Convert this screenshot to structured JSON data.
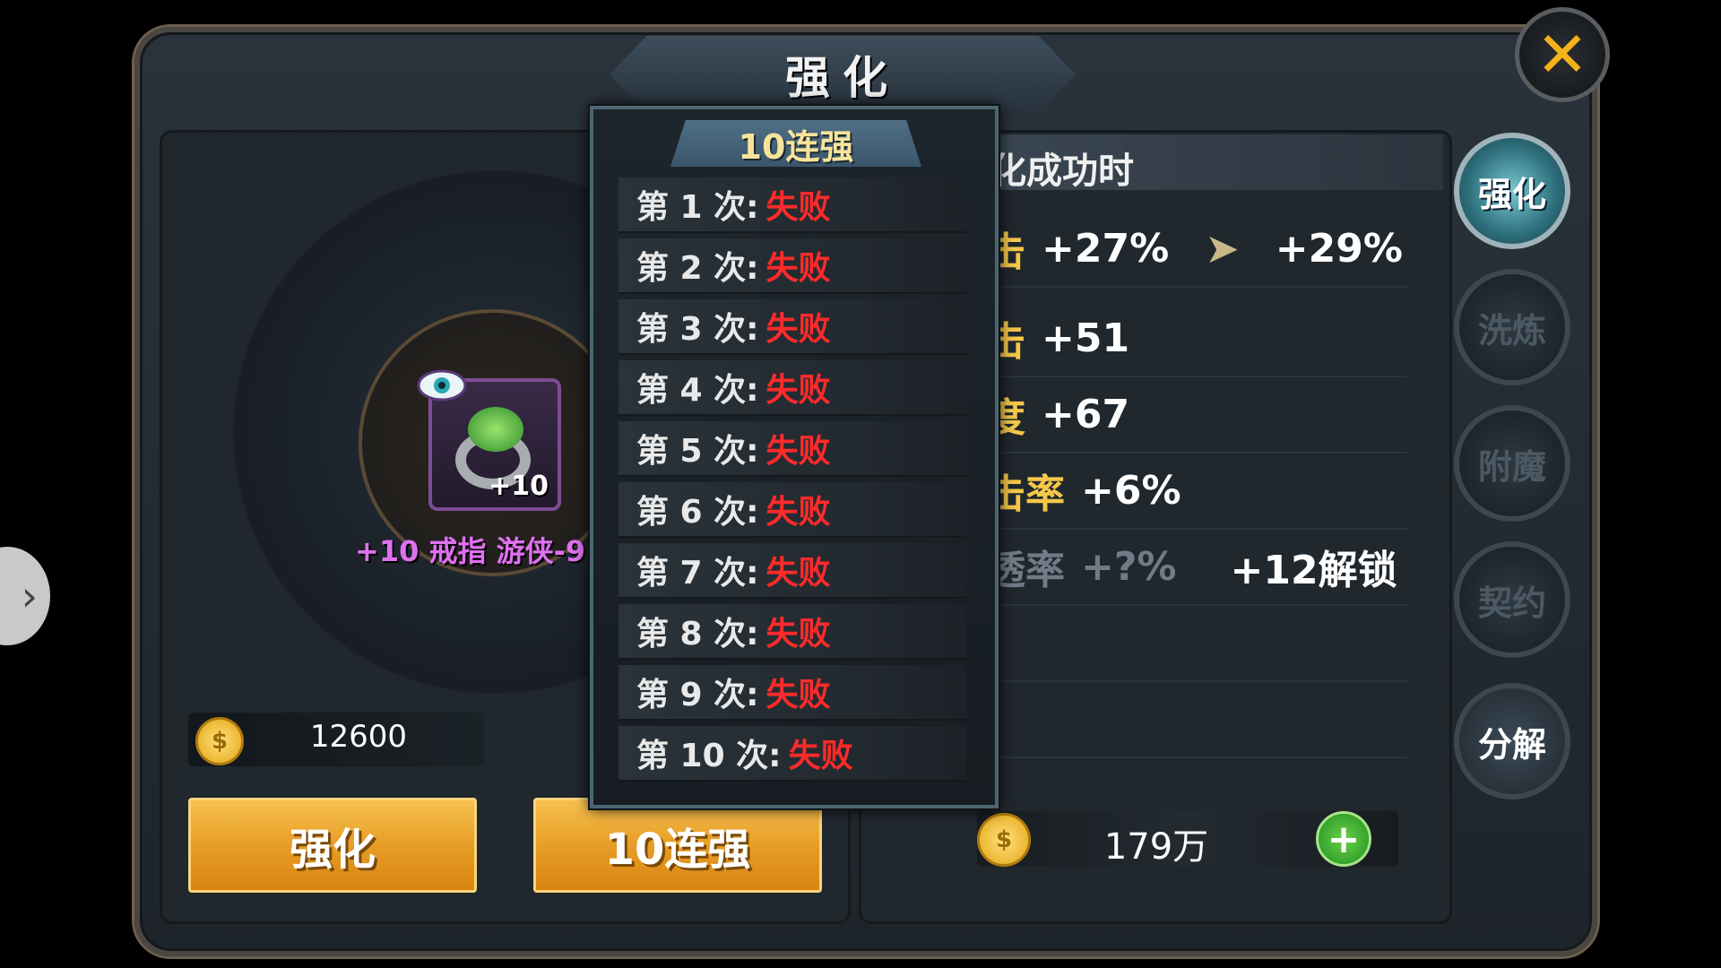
{
  "window": {
    "title": "强化",
    "close_icon": "close-icon"
  },
  "item": {
    "name": "+10 戒指 游侠-9",
    "level_badge": "+10",
    "icon": "ring-icon"
  },
  "cost": {
    "value": "12600",
    "coin_symbol": "$"
  },
  "buttons": {
    "enhance": "强化",
    "ten_enhance": "10连强"
  },
  "success_panel": {
    "title": "化成功时",
    "stats": [
      {
        "name": "击",
        "value": "+27%",
        "next": "+29%"
      },
      {
        "name": "击",
        "value": "+51"
      },
      {
        "name": "度",
        "value": "+67"
      },
      {
        "name": "击率",
        "value": "+6%"
      },
      {
        "name": "透率",
        "value": "+?%",
        "unlock": "+12解锁"
      }
    ]
  },
  "gold": {
    "value": "179万",
    "coin_symbol": "$",
    "plus": "+"
  },
  "side_tabs": [
    "强化",
    "洗炼",
    "附魔",
    "契约",
    "分解"
  ],
  "popup": {
    "title": "10连强",
    "results": [
      {
        "label": "第 1 次:",
        "result": "失败"
      },
      {
        "label": "第 2 次:",
        "result": "失败"
      },
      {
        "label": "第 3 次:",
        "result": "失败"
      },
      {
        "label": "第 4 次:",
        "result": "失败"
      },
      {
        "label": "第 5 次:",
        "result": "失败"
      },
      {
        "label": "第 6 次:",
        "result": "失败"
      },
      {
        "label": "第 7 次:",
        "result": "失败"
      },
      {
        "label": "第 8 次:",
        "result": "失败"
      },
      {
        "label": "第 9 次:",
        "result": "失败"
      },
      {
        "label": "第 10 次:",
        "result": "失败"
      }
    ]
  },
  "colors": {
    "accent": "#f4b21a",
    "fail": "#ff2a2a",
    "item_name": "#e070f0",
    "button": "#e59b24"
  }
}
